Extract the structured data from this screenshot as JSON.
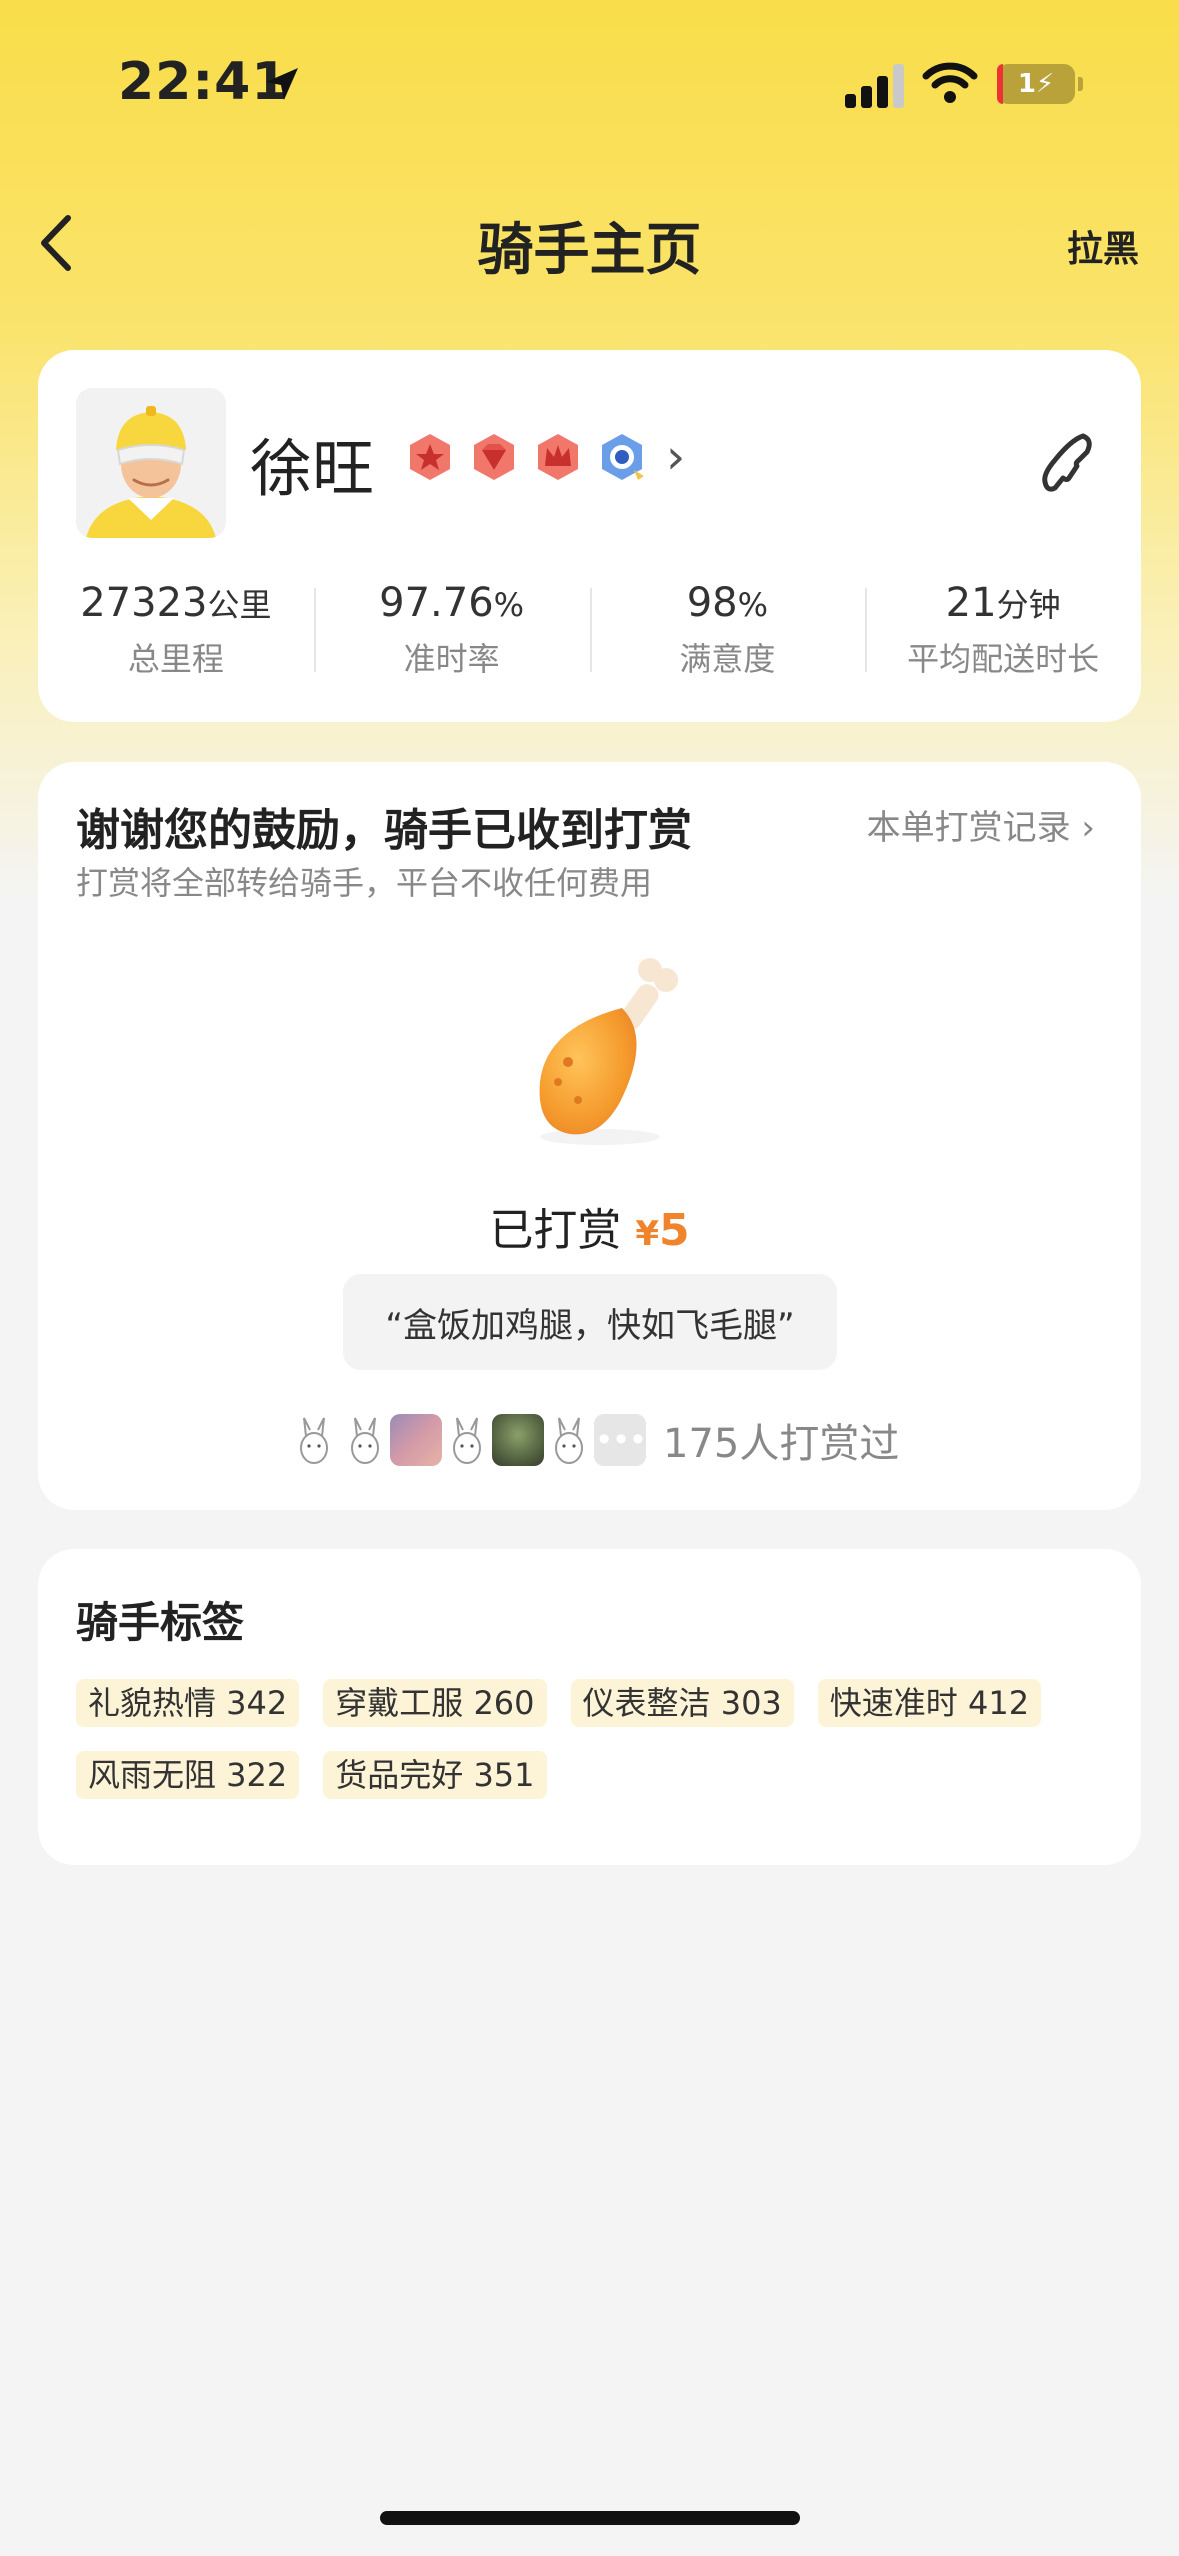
{
  "status_bar": {
    "time": "22:41",
    "battery_level": "1"
  },
  "nav": {
    "title": "骑手主页",
    "blacklist_label": "拉黑"
  },
  "rider": {
    "name": "徐旺",
    "stats": [
      {
        "value": "27323",
        "unit": "公里",
        "label": "总里程"
      },
      {
        "value": "97.76",
        "unit": "%",
        "label": "准时率"
      },
      {
        "value": "98",
        "unit": "%",
        "label": "满意度"
      },
      {
        "value": "21",
        "unit": "分钟",
        "label": "平均配送时长"
      }
    ]
  },
  "tip": {
    "title": "谢谢您的鼓励，骑手已收到打赏",
    "subtitle": "打赏将全部转给骑手，平台不收任何费用",
    "record_link": "本单打赏记录",
    "tipped_label": "已打赏",
    "currency": "¥",
    "amount": "5",
    "message": "“盒饭加鸡腿，快如飞毛腿”",
    "supporters_text": "175人打赏过"
  },
  "tags_section": {
    "title": "骑手标签",
    "tags": [
      "礼貌热情 342",
      "穿戴工服 260",
      "仪表整洁 303",
      "快速准时 412",
      "风雨无阻 322",
      "货品完好 351"
    ]
  },
  "colors": {
    "accent_yellow": "#f9dd4a",
    "tip_orange": "#f0842c",
    "tag_bg": "#fdf4d8"
  }
}
